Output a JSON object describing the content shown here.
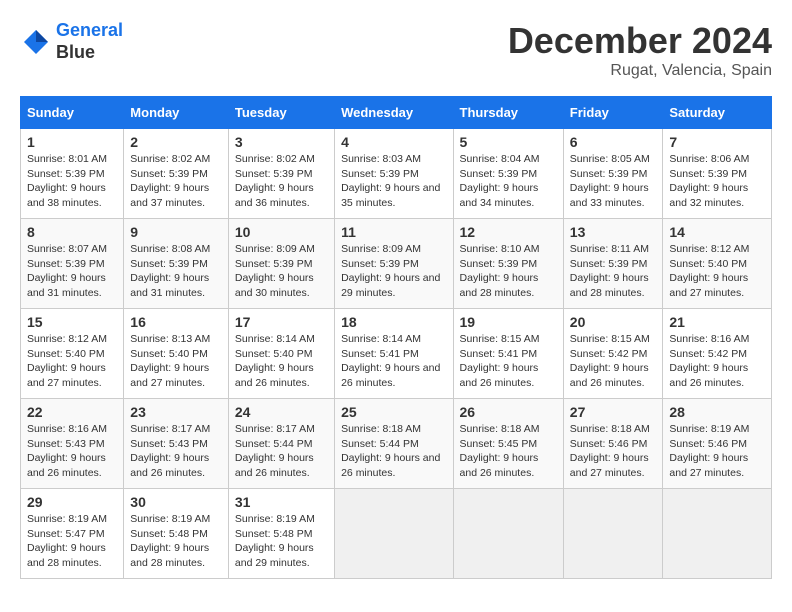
{
  "header": {
    "logo_line1": "General",
    "logo_line2": "Blue",
    "month_title": "December 2024",
    "location": "Rugat, Valencia, Spain"
  },
  "weekdays": [
    "Sunday",
    "Monday",
    "Tuesday",
    "Wednesday",
    "Thursday",
    "Friday",
    "Saturday"
  ],
  "weeks": [
    [
      {
        "day": "1",
        "sunrise": "8:01 AM",
        "sunset": "5:39 PM",
        "daylight": "9 hours and 38 minutes."
      },
      {
        "day": "2",
        "sunrise": "8:02 AM",
        "sunset": "5:39 PM",
        "daylight": "9 hours and 37 minutes."
      },
      {
        "day": "3",
        "sunrise": "8:02 AM",
        "sunset": "5:39 PM",
        "daylight": "9 hours and 36 minutes."
      },
      {
        "day": "4",
        "sunrise": "8:03 AM",
        "sunset": "5:39 PM",
        "daylight": "9 hours and 35 minutes."
      },
      {
        "day": "5",
        "sunrise": "8:04 AM",
        "sunset": "5:39 PM",
        "daylight": "9 hours and 34 minutes."
      },
      {
        "day": "6",
        "sunrise": "8:05 AM",
        "sunset": "5:39 PM",
        "daylight": "9 hours and 33 minutes."
      },
      {
        "day": "7",
        "sunrise": "8:06 AM",
        "sunset": "5:39 PM",
        "daylight": "9 hours and 32 minutes."
      }
    ],
    [
      {
        "day": "8",
        "sunrise": "8:07 AM",
        "sunset": "5:39 PM",
        "daylight": "9 hours and 31 minutes."
      },
      {
        "day": "9",
        "sunrise": "8:08 AM",
        "sunset": "5:39 PM",
        "daylight": "9 hours and 31 minutes."
      },
      {
        "day": "10",
        "sunrise": "8:09 AM",
        "sunset": "5:39 PM",
        "daylight": "9 hours and 30 minutes."
      },
      {
        "day": "11",
        "sunrise": "8:09 AM",
        "sunset": "5:39 PM",
        "daylight": "9 hours and 29 minutes."
      },
      {
        "day": "12",
        "sunrise": "8:10 AM",
        "sunset": "5:39 PM",
        "daylight": "9 hours and 28 minutes."
      },
      {
        "day": "13",
        "sunrise": "8:11 AM",
        "sunset": "5:39 PM",
        "daylight": "9 hours and 28 minutes."
      },
      {
        "day": "14",
        "sunrise": "8:12 AM",
        "sunset": "5:40 PM",
        "daylight": "9 hours and 27 minutes."
      }
    ],
    [
      {
        "day": "15",
        "sunrise": "8:12 AM",
        "sunset": "5:40 PM",
        "daylight": "9 hours and 27 minutes."
      },
      {
        "day": "16",
        "sunrise": "8:13 AM",
        "sunset": "5:40 PM",
        "daylight": "9 hours and 27 minutes."
      },
      {
        "day": "17",
        "sunrise": "8:14 AM",
        "sunset": "5:40 PM",
        "daylight": "9 hours and 26 minutes."
      },
      {
        "day": "18",
        "sunrise": "8:14 AM",
        "sunset": "5:41 PM",
        "daylight": "9 hours and 26 minutes."
      },
      {
        "day": "19",
        "sunrise": "8:15 AM",
        "sunset": "5:41 PM",
        "daylight": "9 hours and 26 minutes."
      },
      {
        "day": "20",
        "sunrise": "8:15 AM",
        "sunset": "5:42 PM",
        "daylight": "9 hours and 26 minutes."
      },
      {
        "day": "21",
        "sunrise": "8:16 AM",
        "sunset": "5:42 PM",
        "daylight": "9 hours and 26 minutes."
      }
    ],
    [
      {
        "day": "22",
        "sunrise": "8:16 AM",
        "sunset": "5:43 PM",
        "daylight": "9 hours and 26 minutes."
      },
      {
        "day": "23",
        "sunrise": "8:17 AM",
        "sunset": "5:43 PM",
        "daylight": "9 hours and 26 minutes."
      },
      {
        "day": "24",
        "sunrise": "8:17 AM",
        "sunset": "5:44 PM",
        "daylight": "9 hours and 26 minutes."
      },
      {
        "day": "25",
        "sunrise": "8:18 AM",
        "sunset": "5:44 PM",
        "daylight": "9 hours and 26 minutes."
      },
      {
        "day": "26",
        "sunrise": "8:18 AM",
        "sunset": "5:45 PM",
        "daylight": "9 hours and 26 minutes."
      },
      {
        "day": "27",
        "sunrise": "8:18 AM",
        "sunset": "5:46 PM",
        "daylight": "9 hours and 27 minutes."
      },
      {
        "day": "28",
        "sunrise": "8:19 AM",
        "sunset": "5:46 PM",
        "daylight": "9 hours and 27 minutes."
      }
    ],
    [
      {
        "day": "29",
        "sunrise": "8:19 AM",
        "sunset": "5:47 PM",
        "daylight": "9 hours and 28 minutes."
      },
      {
        "day": "30",
        "sunrise": "8:19 AM",
        "sunset": "5:48 PM",
        "daylight": "9 hours and 28 minutes."
      },
      {
        "day": "31",
        "sunrise": "8:19 AM",
        "sunset": "5:48 PM",
        "daylight": "9 hours and 29 minutes."
      },
      null,
      null,
      null,
      null
    ]
  ]
}
